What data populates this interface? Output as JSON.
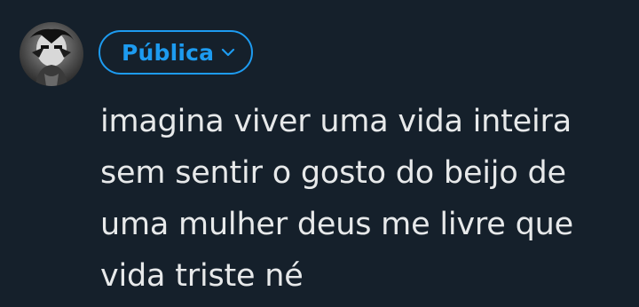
{
  "composer": {
    "audience_label": "Pública",
    "audience_chevron_icon": "chevron-down-icon",
    "avatar_icon": "profile-avatar",
    "text_lines": [
      "imagina viver uma vida inteira",
      "sem sentir o gosto do beijo de",
      "uma mulher deus me livre que",
      "vida triste né"
    ]
  },
  "colors": {
    "background": "#15202b",
    "accent": "#1d9bf0",
    "text": "#e7e9ea"
  }
}
